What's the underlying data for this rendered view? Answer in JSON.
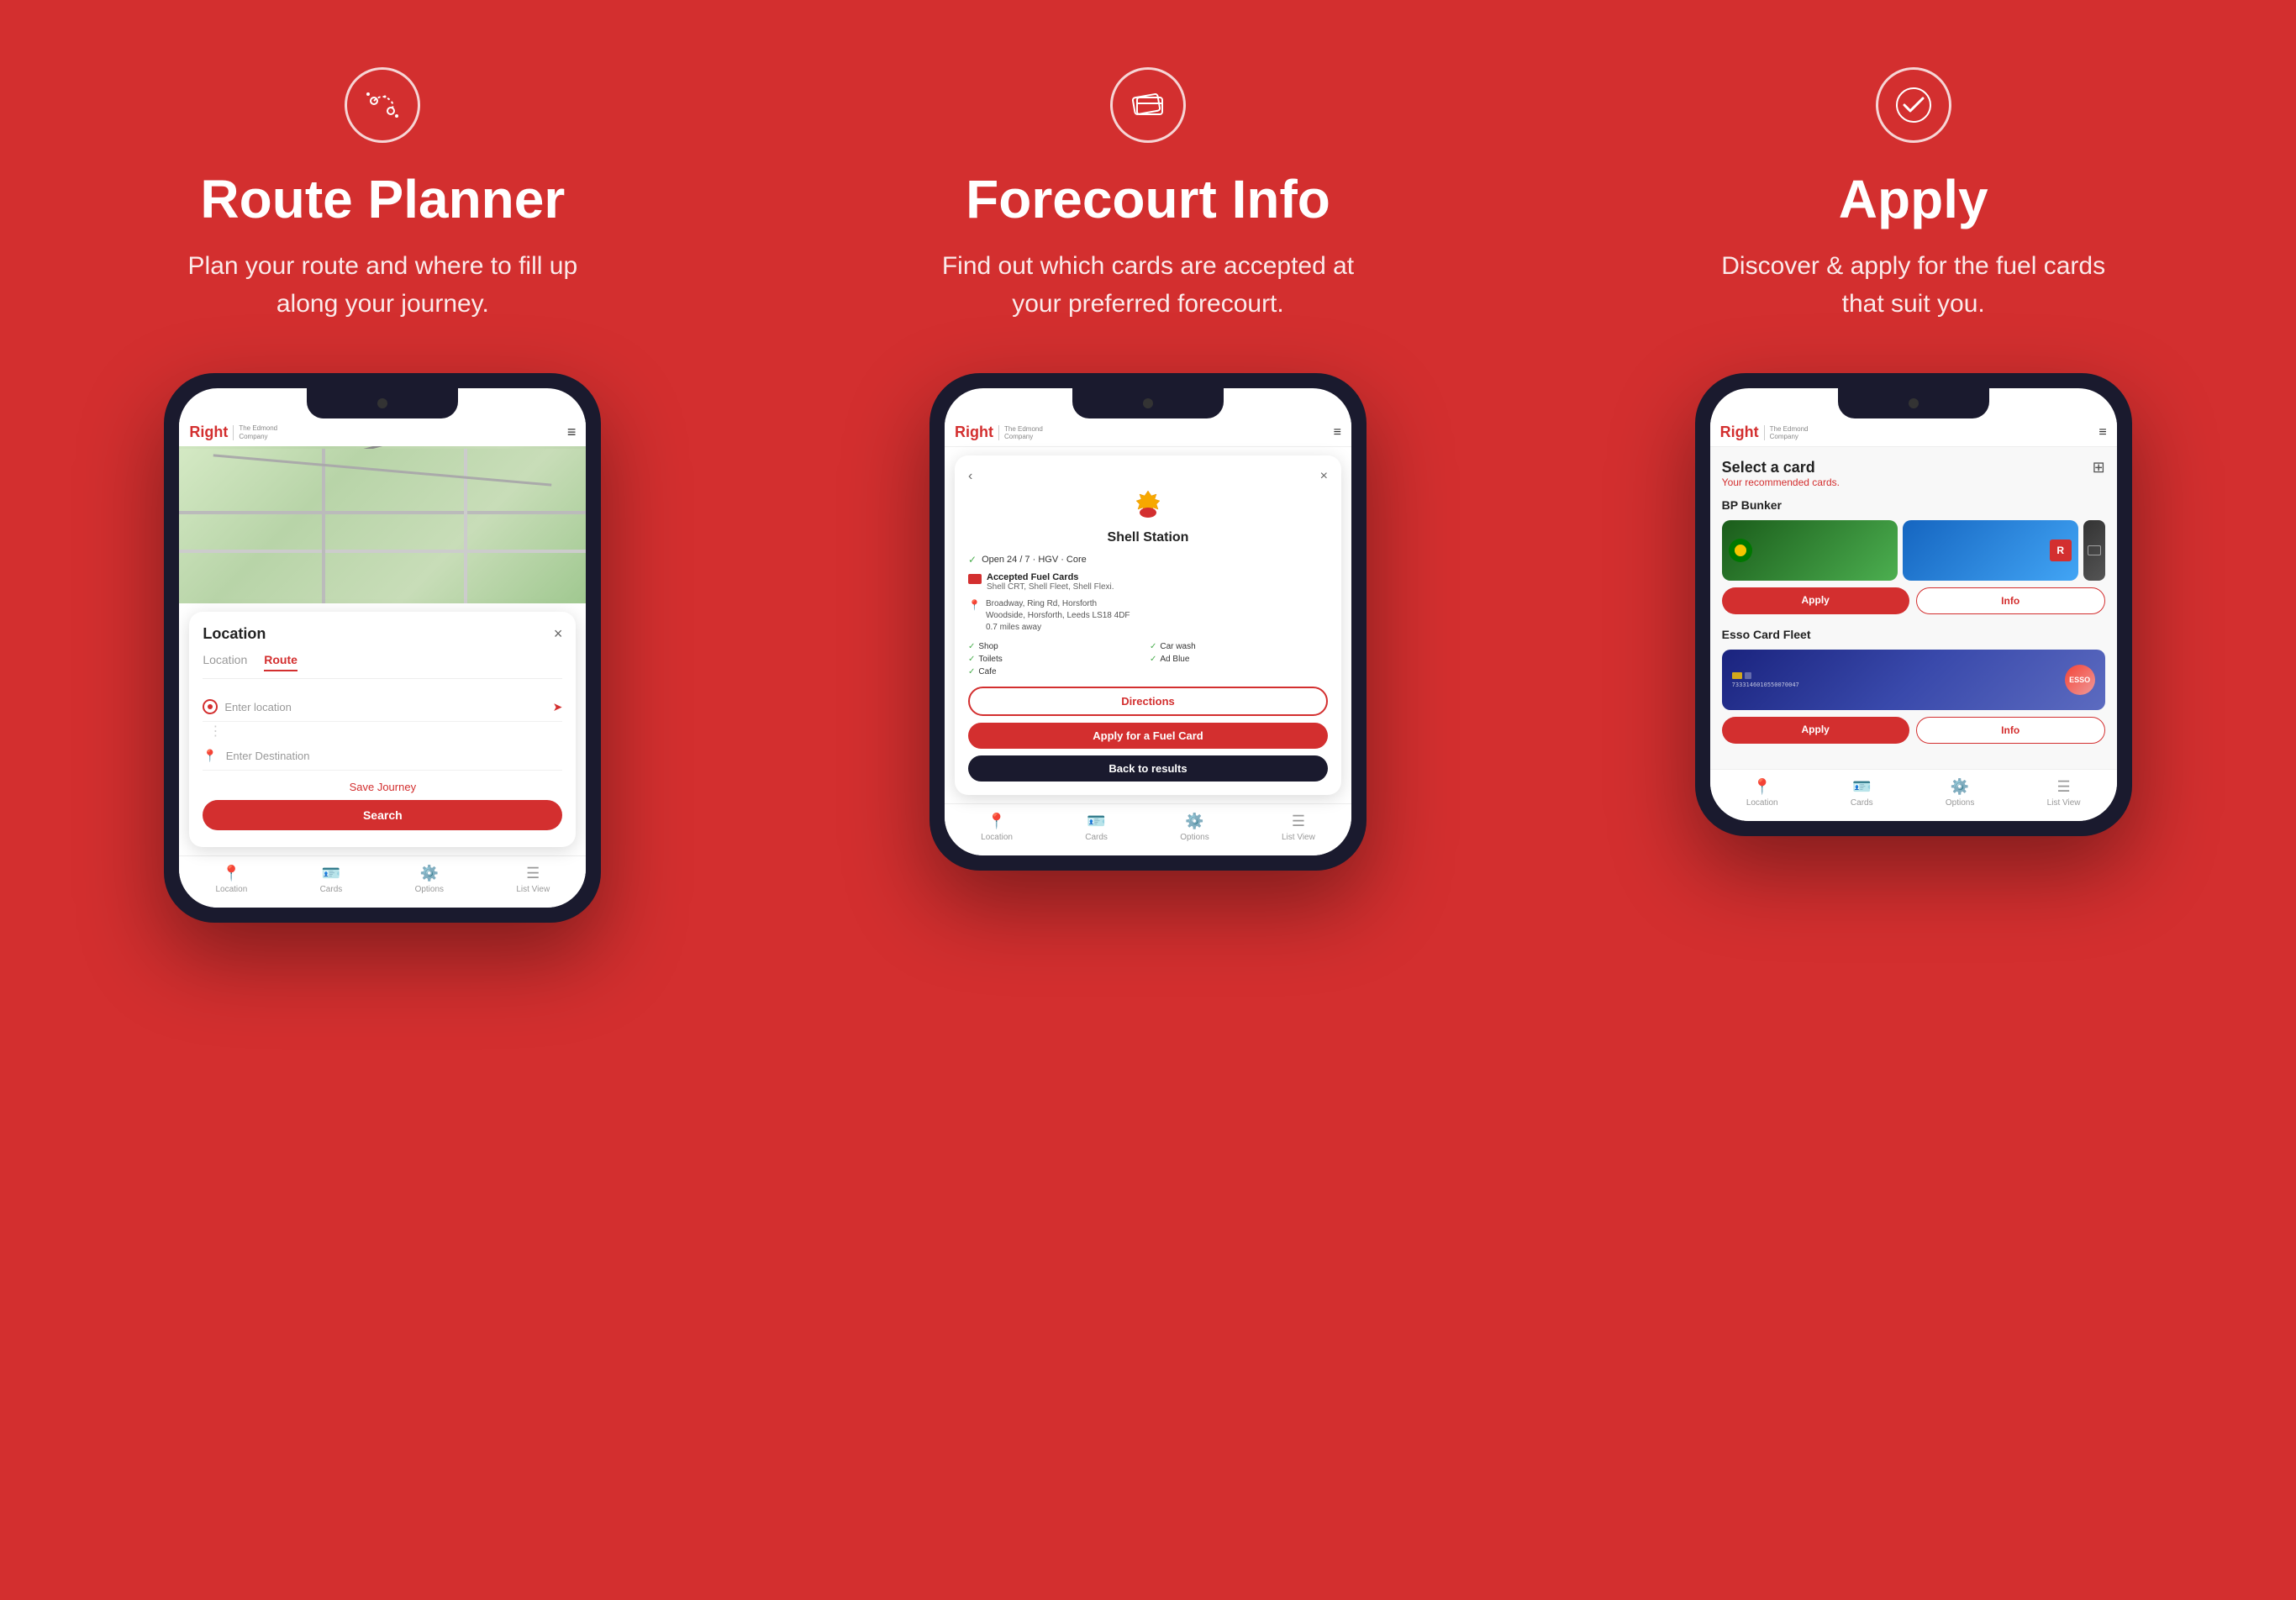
{
  "panels": [
    {
      "id": "route-planner",
      "icon_label": "route-icon",
      "title": "Route Planner",
      "subtitle": "Plan your route and where to fill up along your journey.",
      "phone": {
        "header": {
          "logo": "Right",
          "logo_sub": "The Edmond\nCompany",
          "menu": "≡"
        },
        "modal": {
          "title": "Location",
          "close": "×",
          "tabs": [
            "Location",
            "Route"
          ],
          "active_tab": "Route",
          "input_placeholder": "Enter location",
          "dest_placeholder": "Enter Destination",
          "save_journey": "Save Journey",
          "search_btn": "Search"
        },
        "nav": [
          {
            "icon": "📍",
            "label": "Location"
          },
          {
            "icon": "🃏",
            "label": "Cards"
          },
          {
            "icon": "⚙️",
            "label": "Options"
          },
          {
            "icon": "≡",
            "label": "List View"
          }
        ]
      }
    },
    {
      "id": "forecourt-info",
      "icon_label": "cards-icon",
      "title": "Forecourt Info",
      "subtitle": "Find out which cards are accepted at your preferred forecourt.",
      "phone": {
        "header": {
          "logo": "Right",
          "logo_sub": "The Edmond\nCompany",
          "menu": "≡"
        },
        "modal": {
          "station_name": "Shell Station",
          "open_status": "Open 24 / 7 · HGV · Core",
          "accepted_label": "Accepted Fuel Cards",
          "accepted_cards": "Shell CRT, Shell Fleet, Shell Flexi.",
          "address": "Broadway, Ring Rd, Horsforth\nWoodside, Horsforth, Leeds LS18 4DF\n0.7 miles away",
          "amenities": [
            "Shop",
            "Car wash",
            "Toilets",
            "Ad Blue",
            "Cafe"
          ],
          "directions_btn": "Directions",
          "fuel_card_btn": "Apply for a Fuel Card",
          "back_btn": "Back to results"
        },
        "nav": [
          {
            "icon": "📍",
            "label": "Location"
          },
          {
            "icon": "🃏",
            "label": "Cards"
          },
          {
            "icon": "⚙️",
            "label": "Options"
          },
          {
            "icon": "≡",
            "label": "List View"
          }
        ]
      }
    },
    {
      "id": "apply",
      "icon_label": "check-icon",
      "title": "Apply",
      "subtitle": "Discover & apply for the fuel cards that suit you.",
      "phone": {
        "header": {
          "logo": "Right",
          "logo_sub": "The Edmond\nCompany",
          "menu": "≡"
        },
        "screen": {
          "select_title": "Select a card",
          "recommended": "Your recommended cards.",
          "card1_name": "BP Bunker",
          "card2_name": "Esso Card Fleet",
          "apply_btn": "Apply",
          "info_btn": "Info"
        },
        "nav": [
          {
            "icon": "📍",
            "label": "Location"
          },
          {
            "icon": "🃏",
            "label": "Cards"
          },
          {
            "icon": "⚙️",
            "label": "Options"
          },
          {
            "icon": "≡",
            "label": "List View"
          }
        ]
      }
    }
  ]
}
